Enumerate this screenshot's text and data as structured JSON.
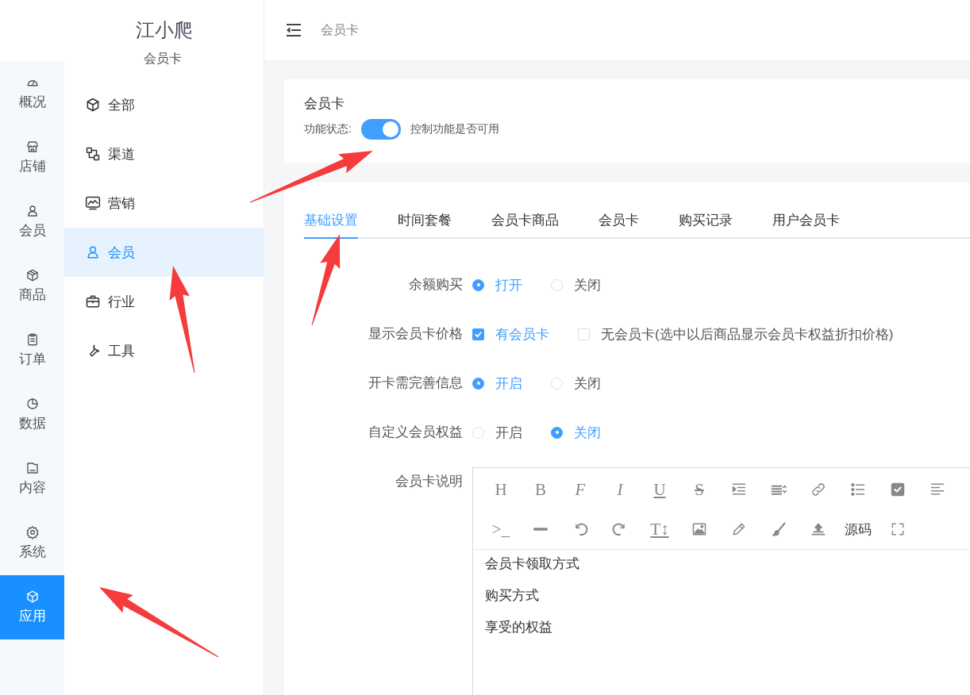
{
  "logo": {
    "title": "江小爬",
    "subtitle": "会员卡"
  },
  "rail": [
    {
      "label": "概况",
      "selected": false
    },
    {
      "label": "店铺",
      "selected": false
    },
    {
      "label": "会员",
      "selected": false
    },
    {
      "label": "商品",
      "selected": false
    },
    {
      "label": "订单",
      "selected": false
    },
    {
      "label": "数据",
      "selected": false
    },
    {
      "label": "内容",
      "selected": false
    },
    {
      "label": "系统",
      "selected": false
    },
    {
      "label": "应用",
      "selected": true
    }
  ],
  "submenu": [
    {
      "label": "全部",
      "selected": false
    },
    {
      "label": "渠道",
      "selected": false
    },
    {
      "label": "营销",
      "selected": false
    },
    {
      "label": "会员",
      "selected": true
    },
    {
      "label": "行业",
      "selected": false
    },
    {
      "label": "工具",
      "selected": false
    }
  ],
  "breadcrumb": "会员卡",
  "feature": {
    "title": "会员卡",
    "label": "功能状态:",
    "on": true,
    "hint": "控制功能是否可用"
  },
  "tabs": [
    {
      "label": "基础设置",
      "selected": true
    },
    {
      "label": "时间套餐",
      "selected": false
    },
    {
      "label": "会员卡商品",
      "selected": false
    },
    {
      "label": "会员卡",
      "selected": false
    },
    {
      "label": "购买记录",
      "selected": false
    },
    {
      "label": "用户会员卡",
      "selected": false
    }
  ],
  "form": [
    {
      "kind": "radio",
      "label": "余额购买",
      "options": [
        {
          "label": "打开",
          "selected": true
        },
        {
          "label": "关闭",
          "selected": false
        }
      ]
    },
    {
      "kind": "checkbox",
      "label": "显示会员卡价格",
      "options": [
        {
          "label": "有会员卡",
          "checked": true
        },
        {
          "label": "无会员卡(选中以后商品显示会员卡权益折扣价格)",
          "checked": false
        }
      ]
    },
    {
      "kind": "radio",
      "label": "开卡需完善信息",
      "options": [
        {
          "label": "开启",
          "selected": true
        },
        {
          "label": "关闭",
          "selected": false
        }
      ]
    },
    {
      "kind": "radio",
      "label": "自定义会员权益",
      "options": [
        {
          "label": "开启",
          "selected": false
        },
        {
          "label": "关闭",
          "selected": true
        }
      ]
    },
    {
      "kind": "editor",
      "label": "会员卡说明",
      "toolbar": [
        [
          {
            "kind": "glyph",
            "text": "H"
          },
          {
            "kind": "glyph",
            "text": "B"
          },
          {
            "kind": "glyph",
            "text": "F"
          },
          {
            "kind": "glyph",
            "text": "I"
          },
          {
            "kind": "glyph",
            "text": "U"
          },
          {
            "kind": "glyph",
            "text": "S"
          },
          {
            "kind": "icon"
          },
          {
            "kind": "icon"
          },
          {
            "kind": "icon"
          },
          {
            "kind": "icon"
          },
          {
            "kind": "icon"
          },
          {
            "kind": "icon"
          }
        ],
        [
          {
            "kind": "glyph",
            "text": ">_"
          },
          {
            "kind": "icon"
          },
          {
            "kind": "icon"
          },
          {
            "kind": "icon"
          },
          {
            "kind": "glyph",
            "text": "T↕"
          },
          {
            "kind": "icon"
          },
          {
            "kind": "icon"
          },
          {
            "kind": "icon"
          },
          {
            "kind": "icon"
          },
          {
            "kind": "text",
            "text": "源码"
          },
          {
            "kind": "icon"
          }
        ]
      ],
      "content": [
        "会员卡领取方式",
        "购买方式",
        "享受的权益"
      ]
    }
  ],
  "annotations": [
    {
      "kind": "arrow"
    },
    {
      "kind": "arrow"
    },
    {
      "kind": "arrow"
    },
    {
      "kind": "arrow"
    }
  ]
}
